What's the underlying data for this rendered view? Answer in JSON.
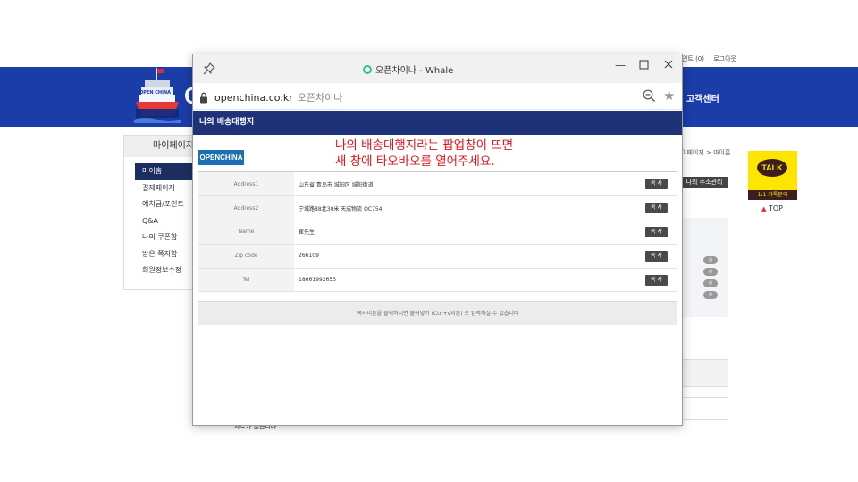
{
  "site": {
    "top_links": [
      "로그인트 (0)",
      "로그아웃"
    ],
    "customer_center": "고객센터",
    "banner_initial": "O",
    "logo_text": "OPEN CHINA",
    "sidebar": {
      "title": "마이페이지",
      "items": [
        {
          "label": "마이홈",
          "active": true
        },
        {
          "label": "결제페이지"
        },
        {
          "label": "예치금/포인트"
        },
        {
          "label": "Q&A"
        },
        {
          "label": "나의 쿠폰함"
        },
        {
          "label": "받은 쪽지함"
        },
        {
          "label": "회원정보수정"
        }
      ]
    },
    "breadcrumb": "이페이지 > 마이홈",
    "address_manage_button": "나의 주소관리",
    "panel_counts": [
      "0",
      "0",
      "0",
      "0"
    ],
    "no_data": "자료가 없습니다.",
    "talk": {
      "label": "TALK",
      "sub": "1:1 카톡문의"
    },
    "top_button": "TOP"
  },
  "popup": {
    "window_title": "오픈차이나 - Whale",
    "url": "openchina.co.kr",
    "site_name": "오픈차이나",
    "header": "나의 배송대행지",
    "brand_logo": "OPENCHINA",
    "annotation": [
      "나의 배송대행지라는 팝업창이 뜨면",
      "새 창에 타오바오를 열어주세요."
    ],
    "rows": [
      {
        "label": "Address1",
        "value": "山东省 青岛市 城阳区 城阳街道",
        "button": "복 사"
      },
      {
        "label": "Address2",
        "value": "宁城路88北30米 天成物流 OC754",
        "button": "복 사"
      },
      {
        "label": "Name",
        "value": "崔先生",
        "button": "복 사"
      },
      {
        "label": "Zip code",
        "value": "266109",
        "button": "복 사"
      },
      {
        "label": "Tel",
        "value": "18661992653",
        "button": "복 사"
      }
    ],
    "help_text": "복사버튼을 클릭하시면 붙여넣기 (Ctrl+v버튼) 로 입력하실 수 있습니다"
  },
  "colors": {
    "banner": "#1a3da8",
    "popup_header": "#1e3278",
    "annotation": "#e0151c",
    "talk_yellow": "#fee500",
    "status_green": "#2bc58a"
  }
}
